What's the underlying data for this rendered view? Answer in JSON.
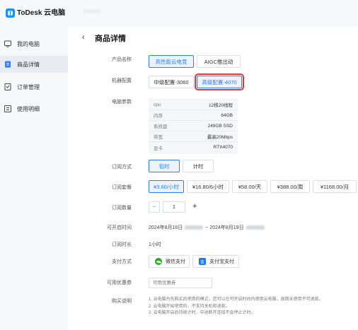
{
  "app": {
    "name": "ToDesk 云电脑"
  },
  "sidebar": {
    "items": [
      {
        "label": "我的电脑",
        "active": false
      },
      {
        "label": "商品详情",
        "active": true
      },
      {
        "label": "订单管理",
        "active": false
      },
      {
        "label": "使用明细",
        "active": false
      }
    ]
  },
  "page": {
    "back_glyph": "‹",
    "title": "商品详情"
  },
  "product_name": {
    "label": "产品名称",
    "options": [
      {
        "label": "高性能云电竞",
        "selected": true
      },
      {
        "label": "AIGC推出动",
        "selected": false
      }
    ]
  },
  "machine_config": {
    "label": "机器配置",
    "options": [
      {
        "label": "中级配置-3060",
        "selected": false
      },
      {
        "label": "高级配置-4070",
        "selected": true
      }
    ]
  },
  "specs": {
    "label": "电脑参数",
    "rows": [
      {
        "key": "cpu",
        "value": "12核20线程"
      },
      {
        "key": "内存",
        "value": "64GB"
      },
      {
        "key": "系统盘",
        "value": "249GB SSD"
      },
      {
        "key": "带宽",
        "value": "最高20Mbps"
      },
      {
        "key": "显卡",
        "value": "RTX4070"
      }
    ]
  },
  "billing_mode": {
    "label": "订阅方式",
    "options": [
      {
        "label": "包时",
        "selected": true
      },
      {
        "label": "计时",
        "selected": false
      }
    ]
  },
  "plans": {
    "label": "订阅套餐",
    "options": [
      {
        "label": "¥3.60/小时",
        "selected": true
      },
      {
        "label": "¥16.80/6小时",
        "selected": false
      },
      {
        "label": "¥58.00/天",
        "selected": false
      },
      {
        "label": "¥388.00/周",
        "selected": false
      },
      {
        "label": "¥1168.00/月",
        "selected": false
      }
    ]
  },
  "quantity": {
    "label": "订阅数量",
    "minus": "−",
    "value": "1",
    "plus": "+"
  },
  "start_time": {
    "label": "可开启时间",
    "from": "2024年8月16日",
    "separator": "~",
    "to": "2024年8月19日"
  },
  "duration": {
    "label": "订阅时长",
    "value": "1小时"
  },
  "payment": {
    "label": "支付方式",
    "wechat": "微信支付",
    "alipay": "支付宝支付",
    "alipay_icon_glyph": "支"
  },
  "coupon": {
    "label": "可用优惠券",
    "placeholder": "可用优惠券"
  },
  "notes": {
    "label": "购买说明",
    "lines": [
      "1. 云电脑为先购买后使用的模式，您可以在可开启时间内使用云电脑，逾期未使用不可退款。",
      "2. 云电脑开始使用后，不支持关机和退款。",
      "3. 云电脑开启后持续计时，中途断开连接不会停止计时。"
    ]
  },
  "colors": {
    "accent": "#2b7cff",
    "highlight": "#e53935",
    "sidebar_bg": "#f7f8fa",
    "wechat": "#1aad19",
    "alipay": "#1677ff"
  }
}
